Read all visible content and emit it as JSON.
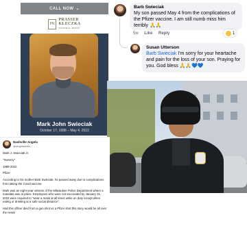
{
  "memorial": {
    "call_label": "CALL NOW",
    "chevron": "⌄",
    "logo_mark": "PK",
    "logo_line1": "PRASSER",
    "logo_line2": "KLECZKA",
    "logo_line3": "FUNERAL HOME",
    "name": "Mark John Swieciak",
    "dates": "October 17, 1988  –  May 4, 2022"
  },
  "facebook": {
    "comment1": {
      "author": "Barb Swieciak",
      "text": "My son passed May 4 from the complications of the Pfizer vaccine. I am still numb miss him terribly",
      "emoji": "🙏🙏",
      "meta_time": "5w",
      "meta_like": "Like",
      "meta_reply": "Reply",
      "reaction_count": "1"
    },
    "comment2": {
      "author": "Susan Utterson",
      "mention": "Barb Swieciak",
      "text": " I'm sorry for your heartache and pain for the loss of your son. Praying for you. God bless",
      "emoji_hands": "🙏🙏",
      "emoji_hearts": "💙💙"
    }
  },
  "tweet": {
    "name": "Nashville Angela",
    "handle": "@angelasmith",
    "paragraphs": [
      "Mark J. Swieciak Jr.",
      "\"Sweezy\"",
      "1988-2022",
      "Pfizer",
      "According to his mother Barb Swieciak, he passed away due to complications from taking the Covid vaccine.",
      "Mark was an eight-year veteran of the Milwaukee Police Department where a mandate was in place. Employees who were not vaccinated by January 31, 2022 were required to \"wear a mask at all times while on duty except when eating or drinking at a safe social distance\".",
      "Had this officer died from a gun shot vs a Pfizer shot this story would be all over the news!"
    ]
  }
}
